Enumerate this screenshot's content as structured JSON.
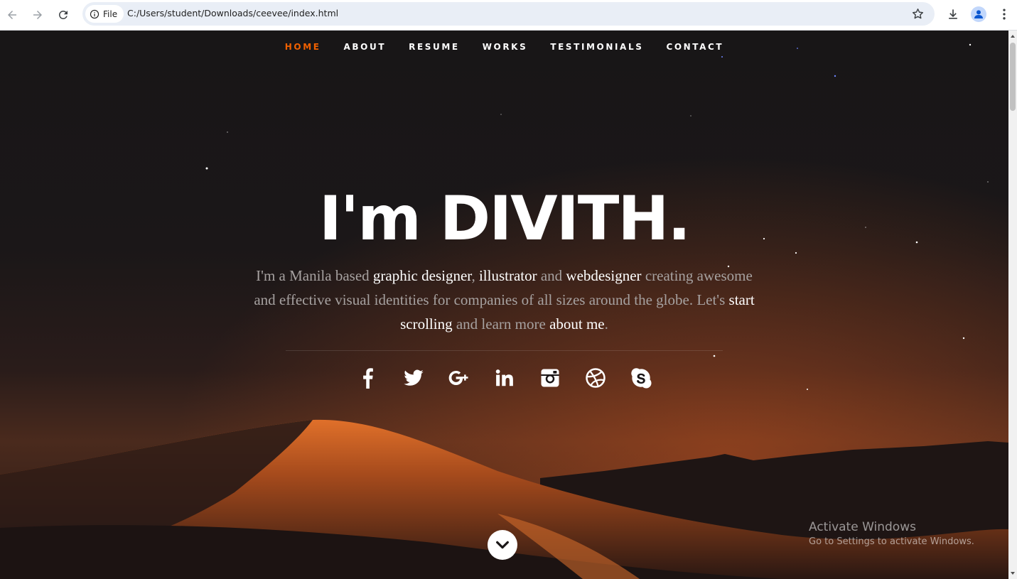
{
  "browser": {
    "file_label": "File",
    "url": "C:/Users/student/Downloads/ceevee/index.html"
  },
  "nav": {
    "items": [
      {
        "label": "HOME",
        "active": true
      },
      {
        "label": "ABOUT",
        "active": false
      },
      {
        "label": "RESUME",
        "active": false
      },
      {
        "label": "WORKS",
        "active": false
      },
      {
        "label": "TESTIMONIALS",
        "active": false
      },
      {
        "label": "CONTACT",
        "active": false
      }
    ],
    "active_color": "#f06000"
  },
  "banner": {
    "headline": "I'm DIVITH.",
    "intro": {
      "t1": "I'm a Manila based ",
      "l1": "graphic designer",
      "t2": ", ",
      "l2": "illustrator",
      "t3": " and ",
      "l3": "webdesigner",
      "t4": " creating awesome and effective visual identities for companies of all sizes around the globe. Let's ",
      "l4": "start scrolling",
      "t5": " and learn more ",
      "l5": "about me",
      "t6": "."
    }
  },
  "socials": [
    "facebook-icon",
    "twitter-icon",
    "google-plus-icon",
    "linkedin-icon",
    "instagram-icon",
    "dribbble-icon",
    "skype-icon"
  ],
  "watermark": {
    "title": "Activate Windows",
    "subtitle": "Go to Settings to activate Windows."
  }
}
